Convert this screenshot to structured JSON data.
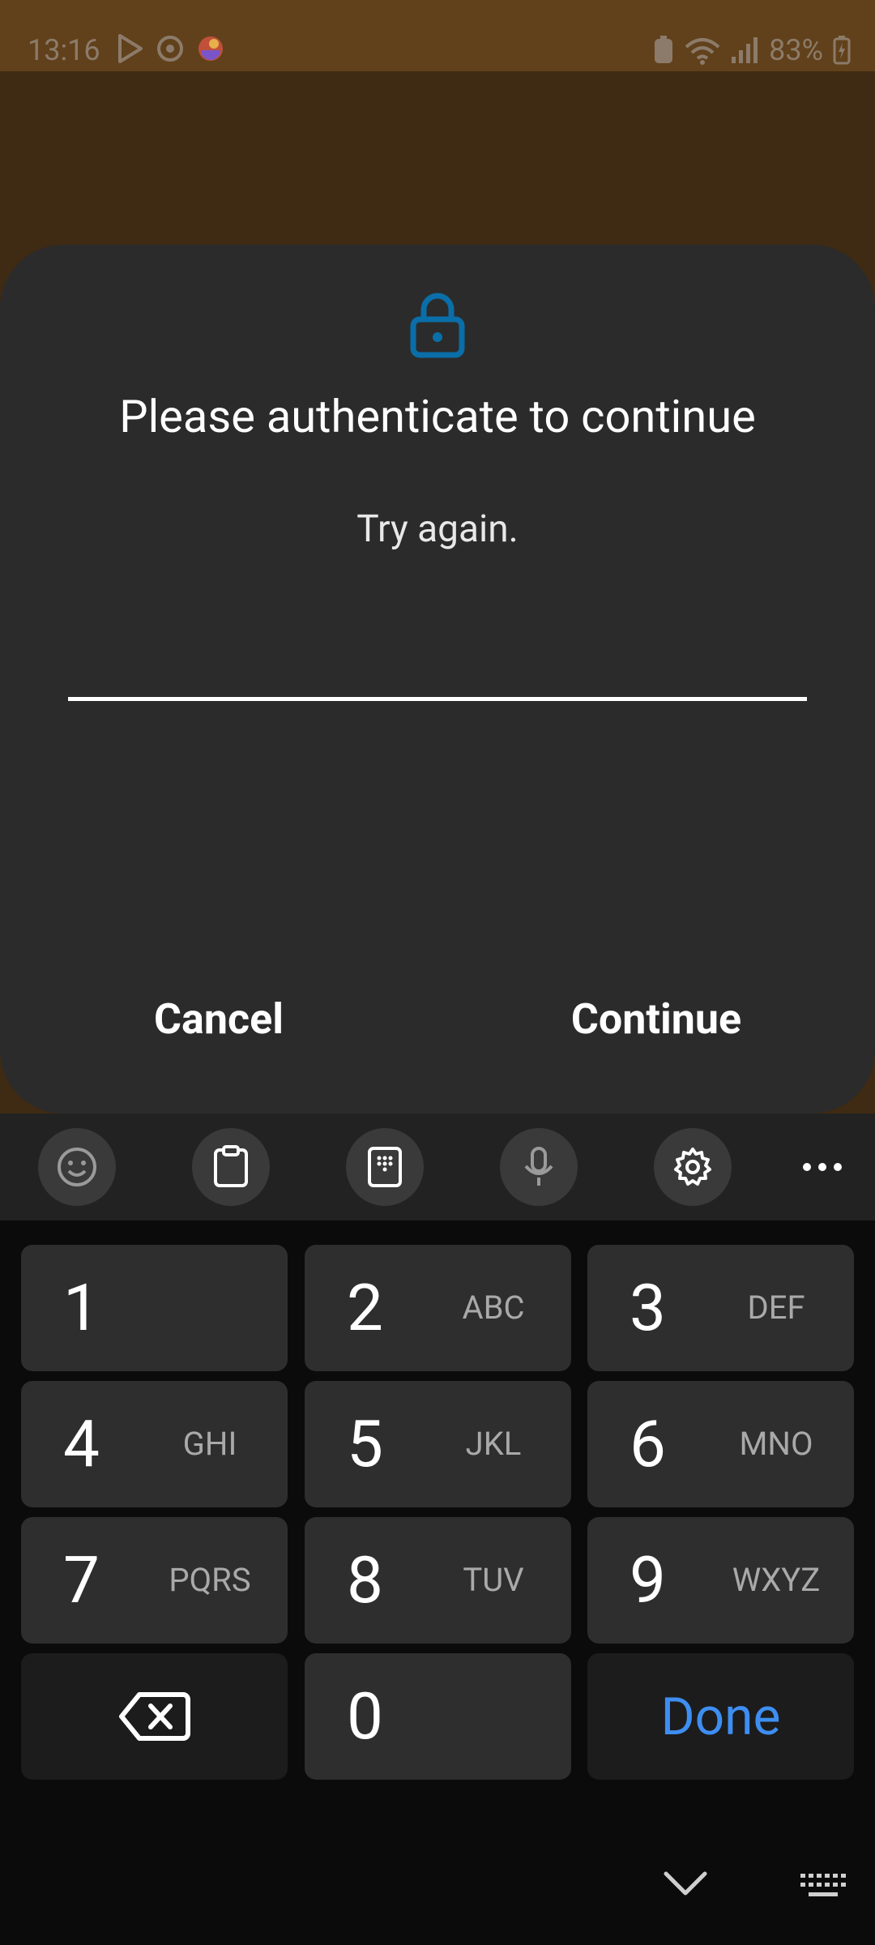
{
  "status_bar": {
    "time": "13:16",
    "battery": "83%"
  },
  "dialog": {
    "title": "Please authenticate to continue",
    "subtitle": "Try again.",
    "pin_value": "",
    "cancel_label": "Cancel",
    "continue_label": "Continue"
  },
  "keyboard": {
    "toolbar": [
      "emoji-icon",
      "clipboard-icon",
      "keypad-icon",
      "microphone-icon",
      "settings-icon",
      "more-icon"
    ],
    "keys": [
      {
        "num": "1",
        "letters": ""
      },
      {
        "num": "2",
        "letters": "ABC"
      },
      {
        "num": "3",
        "letters": "DEF"
      },
      {
        "num": "4",
        "letters": "GHI"
      },
      {
        "num": "5",
        "letters": "JKL"
      },
      {
        "num": "6",
        "letters": "MNO"
      },
      {
        "num": "7",
        "letters": "PQRS"
      },
      {
        "num": "8",
        "letters": "TUV"
      },
      {
        "num": "9",
        "letters": "WXYZ"
      },
      {
        "num": "0",
        "letters": ""
      }
    ],
    "done_label": "Done"
  },
  "colors": {
    "accent": "#3e8ef2",
    "lock": "#0a6ea8",
    "dialog_bg": "#2b2b2b",
    "status_bar": "#61411b"
  }
}
